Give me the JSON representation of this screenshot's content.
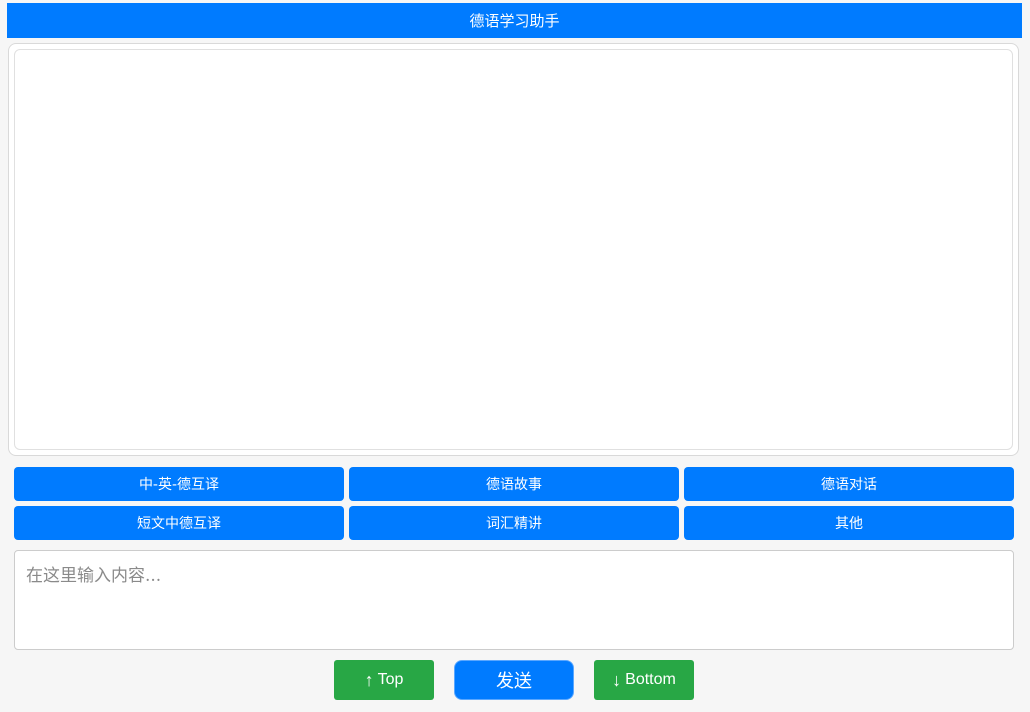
{
  "header": {
    "title": "德语学习助手"
  },
  "modes": [
    {
      "label": "中-英-德互译"
    },
    {
      "label": "德语故事"
    },
    {
      "label": "德语对话"
    },
    {
      "label": "短文中德互译"
    },
    {
      "label": "词汇精讲"
    },
    {
      "label": "其他"
    }
  ],
  "input": {
    "placeholder": "在这里输入内容...",
    "value": ""
  },
  "controls": {
    "top_arrow": "↑",
    "top_label": "Top",
    "send_label": "发送",
    "bottom_arrow": "↓",
    "bottom_label": "Bottom"
  },
  "colors": {
    "primary": "#007bff",
    "success": "#28a745"
  }
}
